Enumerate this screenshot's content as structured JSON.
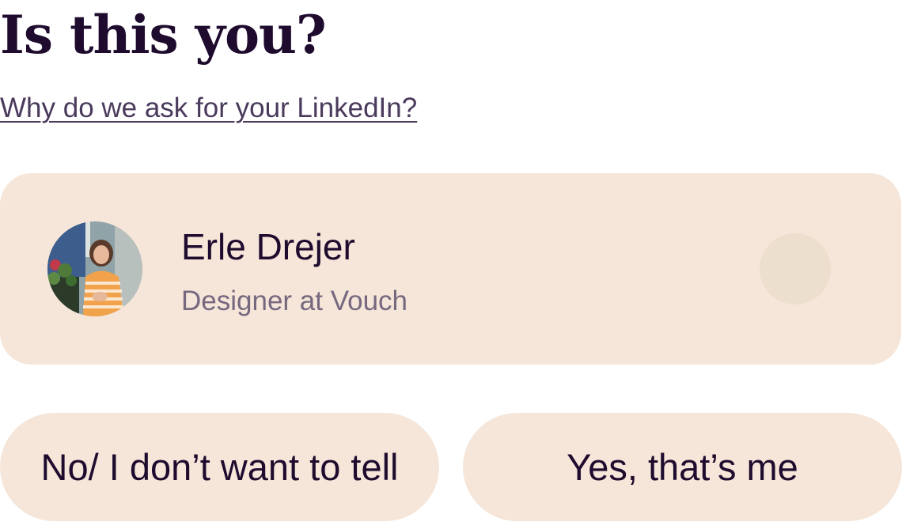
{
  "title": "Is this you?",
  "why_link": "Why do we ask for your LinkedIn?",
  "profile": {
    "name": "Erle Drejer",
    "role": "Designer at Vouch",
    "avatar_icon": "profile-photo"
  },
  "buttons": {
    "no_label": "No/ I don’t want to tell",
    "yes_label": "Yes, that’s me"
  },
  "colors": {
    "text_primary": "#1e0b2e",
    "text_secondary": "#76687f",
    "link": "#4a3a5c",
    "card_background": "#f5e6d9",
    "radio_background": "#eddfce",
    "page_background": "#ffffff"
  }
}
